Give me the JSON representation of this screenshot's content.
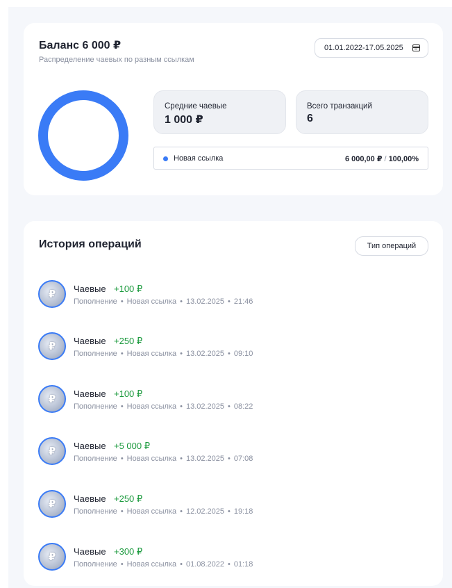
{
  "balance": {
    "title": "Баланс 6 000 ₽",
    "subtitle": "Распределение чаевых по разным ссылкам",
    "date_range": "01.01.2022-17.05.2025",
    "donut_color": "#3a7bf6"
  },
  "stats": {
    "avg_label": "Средние чаевые",
    "avg_value": "1 000 ₽",
    "total_label": "Всего транзакций",
    "total_value": "6"
  },
  "link": {
    "name": "Новая ссылка",
    "amount": "6 000,00 ₽",
    "separator": "/",
    "percent": "100,00%",
    "dot_color": "#3a7bf6"
  },
  "history": {
    "title": "История операций",
    "filter_label": "Тип операций",
    "separator": "•",
    "operations": [
      {
        "title": "Чаевые",
        "amount": "+100 ₽",
        "type": "Пополнение",
        "link": "Новая ссылка",
        "date": "13.02.2025",
        "time": "21:46"
      },
      {
        "title": "Чаевые",
        "amount": "+250 ₽",
        "type": "Пополнение",
        "link": "Новая ссылка",
        "date": "13.02.2025",
        "time": "09:10"
      },
      {
        "title": "Чаевые",
        "amount": "+100 ₽",
        "type": "Пополнение",
        "link": "Новая ссылка",
        "date": "13.02.2025",
        "time": "08:22"
      },
      {
        "title": "Чаевые",
        "amount": "+5 000 ₽",
        "type": "Пополнение",
        "link": "Новая ссылка",
        "date": "13.02.2025",
        "time": "07:08"
      },
      {
        "title": "Чаевые",
        "amount": "+250 ₽",
        "type": "Пополнение",
        "link": "Новая ссылка",
        "date": "12.02.2025",
        "time": "19:18"
      },
      {
        "title": "Чаевые",
        "amount": "+300 ₽",
        "type": "Пополнение",
        "link": "Новая ссылка",
        "date": "01.08.2022",
        "time": "01:18"
      }
    ],
    "amount_color": "#1c9a3e"
  }
}
